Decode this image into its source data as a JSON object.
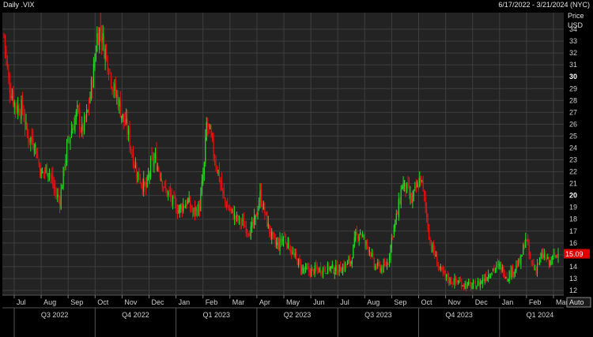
{
  "header": {
    "title": "Daily .VIX",
    "range": "6/17/2022 - 3/21/2024 (NYC)"
  },
  "axis_controls": {
    "auto_label": "Auto"
  },
  "chart_data": {
    "type": "candlestick",
    "title": "Daily .VIX",
    "date_range": "6/17/2022 - 3/21/2024 (NYC)",
    "ylabel": [
      "Price",
      "USD"
    ],
    "ylim": [
      11.6,
      35.4
    ],
    "yticks": [
      12,
      13,
      14,
      15,
      16,
      17,
      18,
      19,
      20,
      21,
      22,
      23,
      24,
      25,
      26,
      27,
      28,
      29,
      30,
      31,
      32,
      33,
      34
    ],
    "ytick_bold": [
      20,
      30
    ],
    "months": [
      "Jul",
      "Aug",
      "Sep",
      "Oct",
      "Nov",
      "Dec",
      "Jan",
      "Feb",
      "Mar",
      "Apr",
      "May",
      "Jun",
      "Jul",
      "Aug",
      "Sep",
      "Oct",
      "Nov",
      "Dec",
      "Jan",
      "Feb",
      "Mar"
    ],
    "quarters": [
      "Q3 2022",
      "Q4 2022",
      "Q1 2023",
      "Q2 2023",
      "Q3 2023",
      "Q4 2023",
      "Q1 2024"
    ],
    "last_price": "15.09",
    "grid": true,
    "colors": {
      "up": "#22dd22",
      "down": "#ee1111",
      "background": "#232323",
      "grid": "#3e3e3e",
      "last_price_tag": "#e00000"
    },
    "close_path": [
      {
        "x": 0,
        "y": 33.5
      },
      {
        "x": 4,
        "y": 29.5
      },
      {
        "x": 10,
        "y": 27.5
      },
      {
        "x": 16,
        "y": 27.2
      },
      {
        "x": 20,
        "y": 25.0
      },
      {
        "x": 26,
        "y": 24.5
      },
      {
        "x": 32,
        "y": 21.8
      },
      {
        "x": 38,
        "y": 22.3
      },
      {
        "x": 44,
        "y": 20.2
      },
      {
        "x": 48,
        "y": 19.6
      },
      {
        "x": 54,
        "y": 24.0
      },
      {
        "x": 58,
        "y": 25.5
      },
      {
        "x": 63,
        "y": 27.0
      },
      {
        "x": 67,
        "y": 25.3
      },
      {
        "x": 72,
        "y": 27.0
      },
      {
        "x": 77,
        "y": 30.5
      },
      {
        "x": 80,
        "y": 33.5
      },
      {
        "x": 83,
        "y": 34.0
      },
      {
        "x": 86,
        "y": 32.5
      },
      {
        "x": 90,
        "y": 31.0
      },
      {
        "x": 94,
        "y": 29.0
      },
      {
        "x": 98,
        "y": 28.0
      },
      {
        "x": 102,
        "y": 26.5
      },
      {
        "x": 106,
        "y": 25.5
      },
      {
        "x": 110,
        "y": 23.5
      },
      {
        "x": 114,
        "y": 22.0
      },
      {
        "x": 118,
        "y": 21.2
      },
      {
        "x": 122,
        "y": 20.5
      },
      {
        "x": 126,
        "y": 22.5
      },
      {
        "x": 130,
        "y": 23.0
      },
      {
        "x": 134,
        "y": 22.0
      },
      {
        "x": 138,
        "y": 20.5
      },
      {
        "x": 142,
        "y": 20.0
      },
      {
        "x": 146,
        "y": 19.2
      },
      {
        "x": 150,
        "y": 18.8
      },
      {
        "x": 154,
        "y": 19.2
      },
      {
        "x": 158,
        "y": 19.5
      },
      {
        "x": 162,
        "y": 18.5
      },
      {
        "x": 168,
        "y": 19.0
      },
      {
        "x": 172,
        "y": 22.5
      },
      {
        "x": 174,
        "y": 26.0
      },
      {
        "x": 177,
        "y": 25.2
      },
      {
        "x": 180,
        "y": 23.5
      },
      {
        "x": 184,
        "y": 22.0
      },
      {
        "x": 188,
        "y": 20.0
      },
      {
        "x": 192,
        "y": 19.0
      },
      {
        "x": 196,
        "y": 18.5
      },
      {
        "x": 200,
        "y": 18.0
      },
      {
        "x": 206,
        "y": 17.5
      },
      {
        "x": 212,
        "y": 17.0
      },
      {
        "x": 216,
        "y": 18.0
      },
      {
        "x": 220,
        "y": 20.0
      },
      {
        "x": 224,
        "y": 18.5
      },
      {
        "x": 228,
        "y": 17.0
      },
      {
        "x": 232,
        "y": 16.0
      },
      {
        "x": 236,
        "y": 15.8
      },
      {
        "x": 240,
        "y": 16.5
      },
      {
        "x": 244,
        "y": 16.0
      },
      {
        "x": 248,
        "y": 15.0
      },
      {
        "x": 252,
        "y": 14.5
      },
      {
        "x": 256,
        "y": 13.8
      },
      {
        "x": 262,
        "y": 13.6
      },
      {
        "x": 268,
        "y": 13.7
      },
      {
        "x": 274,
        "y": 13.8
      },
      {
        "x": 280,
        "y": 13.9
      },
      {
        "x": 286,
        "y": 13.7
      },
      {
        "x": 292,
        "y": 14.0
      },
      {
        "x": 298,
        "y": 14.5
      },
      {
        "x": 302,
        "y": 16.5
      },
      {
        "x": 306,
        "y": 17.0
      },
      {
        "x": 310,
        "y": 16.0
      },
      {
        "x": 314,
        "y": 15.5
      },
      {
        "x": 318,
        "y": 14.0
      },
      {
        "x": 322,
        "y": 14.0
      },
      {
        "x": 326,
        "y": 13.8
      },
      {
        "x": 330,
        "y": 14.5
      },
      {
        "x": 334,
        "y": 17.0
      },
      {
        "x": 338,
        "y": 18.5
      },
      {
        "x": 342,
        "y": 21.0
      },
      {
        "x": 346,
        "y": 20.5
      },
      {
        "x": 350,
        "y": 19.5
      },
      {
        "x": 354,
        "y": 20.5
      },
      {
        "x": 358,
        "y": 21.5
      },
      {
        "x": 362,
        "y": 19.0
      },
      {
        "x": 366,
        "y": 16.0
      },
      {
        "x": 370,
        "y": 15.0
      },
      {
        "x": 374,
        "y": 13.8
      },
      {
        "x": 378,
        "y": 13.2
      },
      {
        "x": 384,
        "y": 12.8
      },
      {
        "x": 390,
        "y": 12.7
      },
      {
        "x": 396,
        "y": 12.5
      },
      {
        "x": 402,
        "y": 12.3
      },
      {
        "x": 408,
        "y": 12.6
      },
      {
        "x": 414,
        "y": 13.2
      },
      {
        "x": 420,
        "y": 13.8
      },
      {
        "x": 426,
        "y": 14.0
      },
      {
        "x": 432,
        "y": 13.2
      },
      {
        "x": 438,
        "y": 13.8
      },
      {
        "x": 444,
        "y": 14.5
      },
      {
        "x": 448,
        "y": 16.5
      },
      {
        "x": 452,
        "y": 14.5
      },
      {
        "x": 456,
        "y": 13.8
      },
      {
        "x": 460,
        "y": 14.5
      },
      {
        "x": 464,
        "y": 15.0
      },
      {
        "x": 468,
        "y": 14.2
      },
      {
        "x": 472,
        "y": 14.8
      },
      {
        "x": 476,
        "y": 15.09
      }
    ]
  }
}
